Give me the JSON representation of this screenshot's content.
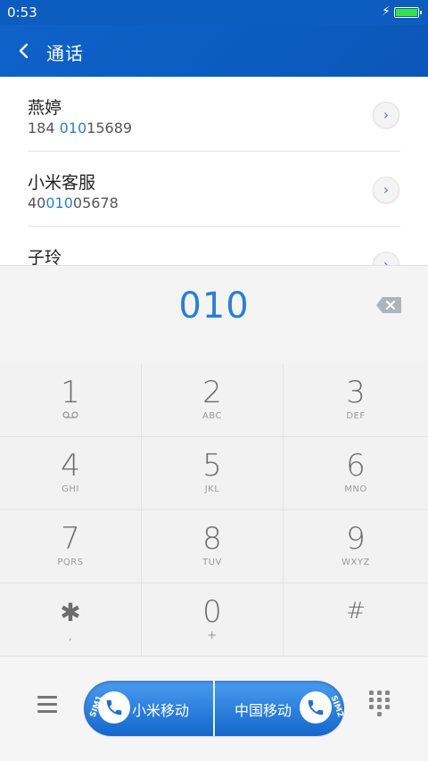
{
  "status": {
    "time": "0:53",
    "charging_icon": "bolt-icon",
    "battery_color": "#35e24a"
  },
  "header": {
    "title": "通话",
    "back_icon": "chevron-left-icon",
    "color": "#0b5cc2"
  },
  "results": [
    {
      "name": "燕婷",
      "num_pre": "184 ",
      "num_match": "010",
      "num_post": "15689"
    },
    {
      "name": "小米客服",
      "num_pre": "40",
      "num_match": "010",
      "num_post": "05678"
    },
    {
      "name": "子玲",
      "num_pre": "",
      "num_match": "",
      "num_post": ""
    }
  ],
  "dialer": {
    "digits": "010",
    "backspace_icon": "backspace-icon",
    "keys": [
      {
        "main": "1",
        "sub": "voicemail"
      },
      {
        "main": "2",
        "sub": "ABC"
      },
      {
        "main": "3",
        "sub": "DEF"
      },
      {
        "main": "4",
        "sub": "GHI"
      },
      {
        "main": "5",
        "sub": "JKL"
      },
      {
        "main": "6",
        "sub": "MNO"
      },
      {
        "main": "7",
        "sub": "PQRS"
      },
      {
        "main": "8",
        "sub": "TUV"
      },
      {
        "main": "9",
        "sub": "WXYZ"
      },
      {
        "main": "✱",
        "sub": ","
      },
      {
        "main": "0",
        "sub": "+"
      },
      {
        "main": "#",
        "sub": ""
      }
    ]
  },
  "bottom": {
    "menu_icon": "menu-icon",
    "sim1": {
      "tag": "SIM1",
      "carrier": "小米移动"
    },
    "sim2": {
      "tag": "SIM2",
      "carrier": "中国移动"
    },
    "keypad_icon": "dialpad-icon",
    "accent": "#1a70d4"
  }
}
